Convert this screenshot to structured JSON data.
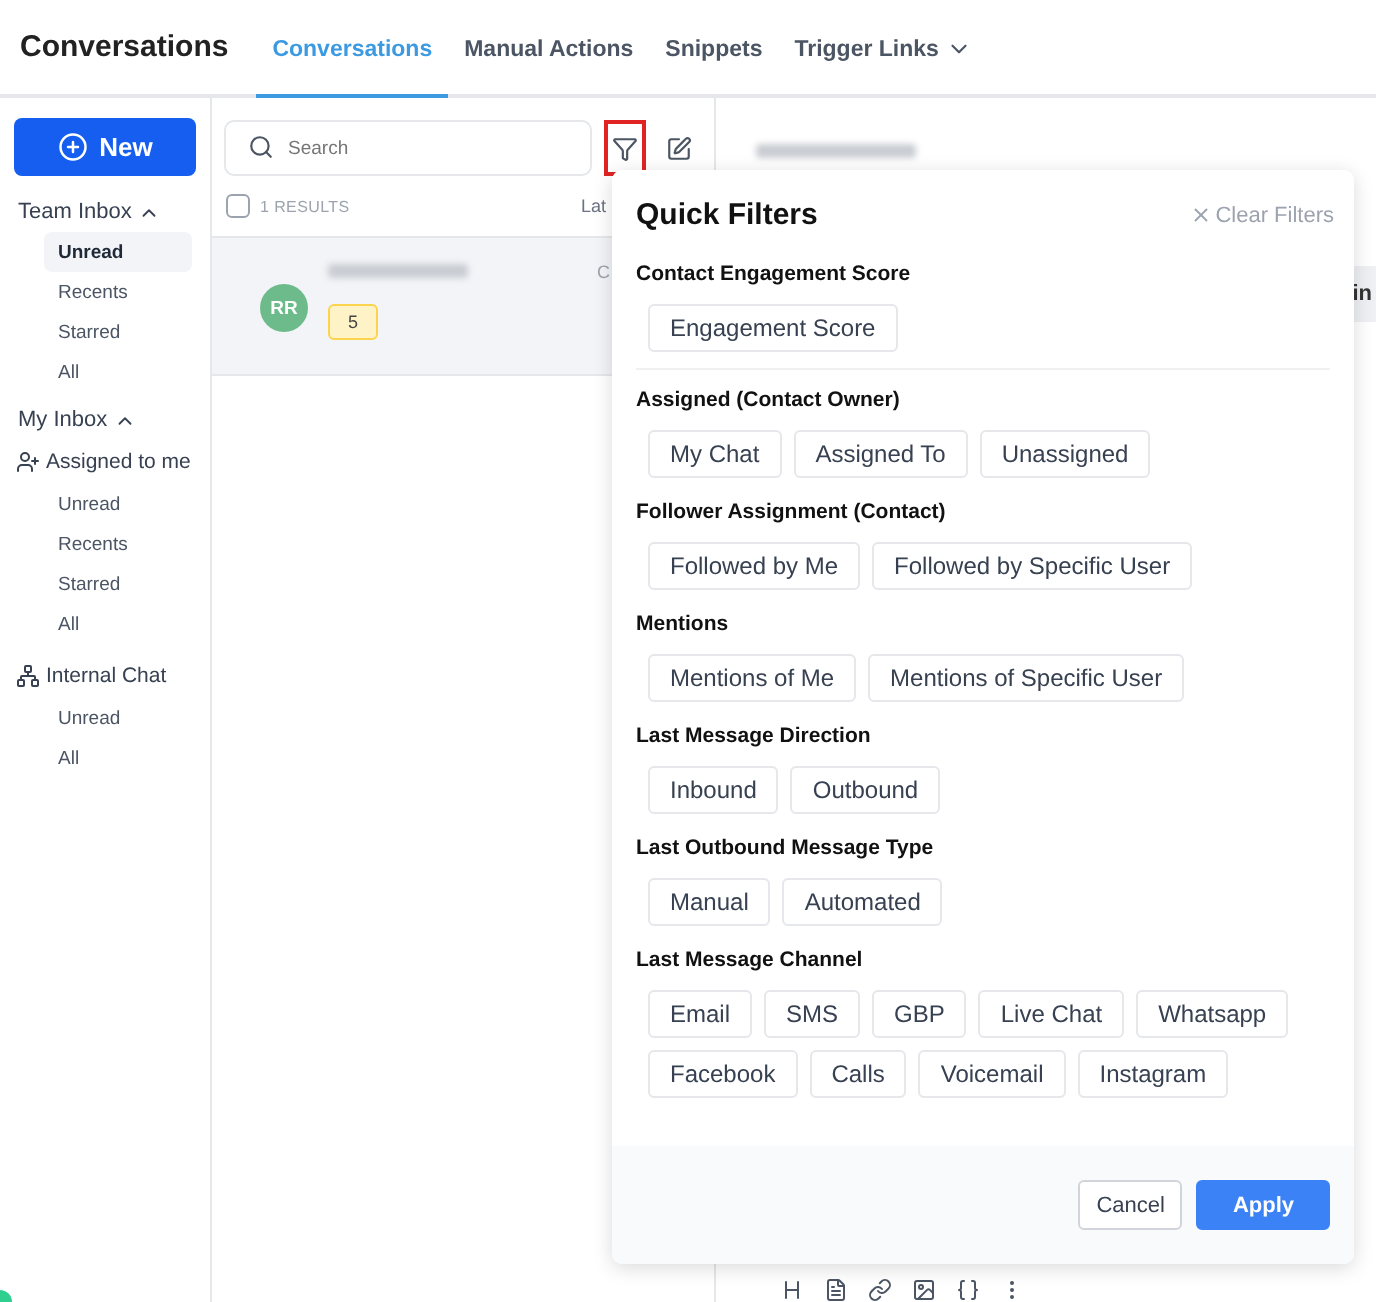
{
  "header": {
    "title": "Conversations",
    "tabs": [
      {
        "label": "Conversations",
        "selected": true,
        "dropdown": false
      },
      {
        "label": "Manual Actions",
        "selected": false,
        "dropdown": false
      },
      {
        "label": "Snippets",
        "selected": false,
        "dropdown": false
      },
      {
        "label": "Trigger Links",
        "selected": false,
        "dropdown": true
      }
    ]
  },
  "sidebar": {
    "new_button": "New",
    "groups": [
      {
        "title": "Team Inbox",
        "expanded": true,
        "items": [
          {
            "label": "Unread",
            "selected": true
          },
          {
            "label": "Recents",
            "selected": false
          },
          {
            "label": "Starred",
            "selected": false
          },
          {
            "label": "All",
            "selected": false
          }
        ]
      },
      {
        "title": "My Inbox",
        "expanded": true,
        "subgroups": [
          {
            "title": "Assigned to me",
            "kind": "person",
            "items": [
              {
                "label": "Unread",
                "selected": false
              },
              {
                "label": "Recents",
                "selected": false
              },
              {
                "label": "Starred",
                "selected": false
              },
              {
                "label": "All",
                "selected": false
              }
            ]
          },
          {
            "title": "Internal Chat",
            "kind": "network",
            "items": [
              {
                "label": "Unread",
                "selected": false
              },
              {
                "label": "All",
                "selected": false
              }
            ]
          }
        ]
      }
    ]
  },
  "list": {
    "search": {
      "placeholder": "Search"
    },
    "filter_active": true,
    "select_all_checked": false,
    "results": "1 RESULTS",
    "sort_label": "Lat",
    "conversations": [
      {
        "initials": "RR",
        "color": "#6dbb8a",
        "badge": "5",
        "time": "C",
        "selected": true
      }
    ]
  },
  "detail": {
    "edge_text": "in"
  },
  "quick_filters": {
    "title": "Quick Filters",
    "clear": "Clear Filters",
    "sections": [
      {
        "title": "Contact Engagement Score",
        "divider": true,
        "options": [
          {
            "label": "Engagement Score",
            "selected": false
          }
        ]
      },
      {
        "title": "Assigned (Contact Owner)",
        "divider": false,
        "options": [
          {
            "label": "My Chat",
            "selected": false
          },
          {
            "label": "Assigned To",
            "selected": false
          },
          {
            "label": "Unassigned",
            "selected": false
          }
        ]
      },
      {
        "title": "Follower Assignment (Contact)",
        "divider": false,
        "options": [
          {
            "label": "Followed by Me",
            "selected": false
          },
          {
            "label": "Followed by Specific User",
            "selected": false
          }
        ]
      },
      {
        "title": "Mentions",
        "divider": false,
        "options": [
          {
            "label": "Mentions of Me",
            "selected": false
          },
          {
            "label": "Mentions of Specific User",
            "selected": false
          }
        ]
      },
      {
        "title": "Last Message Direction",
        "divider": false,
        "options": [
          {
            "label": "Inbound",
            "selected": false
          },
          {
            "label": "Outbound",
            "selected": false
          }
        ]
      },
      {
        "title": "Last Outbound Message Type",
        "divider": false,
        "options": [
          {
            "label": "Manual",
            "selected": false
          },
          {
            "label": "Automated",
            "selected": false
          }
        ]
      },
      {
        "title": "Last Message Channel",
        "divider": false,
        "options": [
          {
            "label": "Email",
            "selected": false
          },
          {
            "label": "SMS",
            "selected": false
          },
          {
            "label": "GBP",
            "selected": false
          },
          {
            "label": "Live Chat",
            "selected": false
          },
          {
            "label": "Whatsapp",
            "selected": false
          },
          {
            "label": "Facebook",
            "selected": false
          },
          {
            "label": "Calls",
            "selected": false
          },
          {
            "label": "Voicemail",
            "selected": false
          },
          {
            "label": "Instagram",
            "selected": false
          }
        ]
      }
    ],
    "buttons": [
      {
        "label": "Cancel",
        "kind": "secondary"
      },
      {
        "label": "Apply",
        "kind": "primary"
      }
    ]
  }
}
